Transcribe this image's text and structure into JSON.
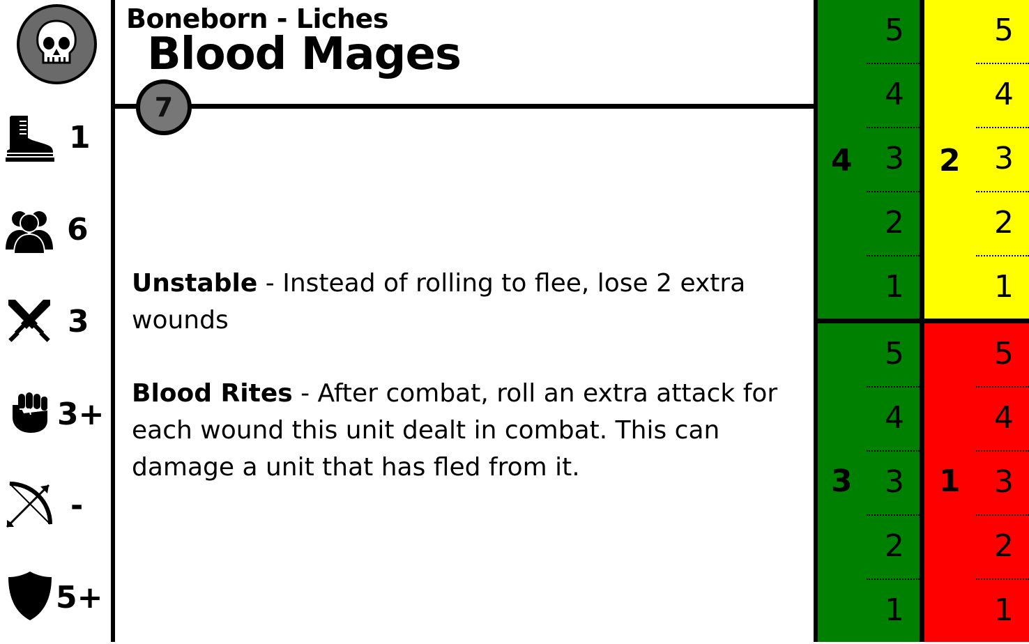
{
  "card": {
    "subtitle": "Boneborn - Liches",
    "title": "Blood Mages",
    "cost": "7"
  },
  "stats": [
    {
      "icon": "boot-icon",
      "value": "1"
    },
    {
      "icon": "group-icon",
      "value": "6"
    },
    {
      "icon": "crossed-swords-icon",
      "value": "3"
    },
    {
      "icon": "fist-icon",
      "value": "3+"
    },
    {
      "icon": "bow-icon",
      "value": "-"
    },
    {
      "icon": "shield-icon",
      "value": "5+"
    }
  ],
  "rules": [
    {
      "name": "Unstable",
      "text": " - Instead of rolling to flee, lose 2 extra wounds"
    },
    {
      "name": "Blood Rites",
      "text": " - After combat, roll an extra attack for each wound this unit dealt in combat. This can damage a unit that has fled from it."
    }
  ],
  "track": {
    "blocks": [
      {
        "label": "4",
        "color": "#008000",
        "numbers": [
          "5",
          "4",
          "3",
          "2",
          "1"
        ]
      },
      {
        "label": "2",
        "color": "#ffff00",
        "numbers": [
          "5",
          "4",
          "3",
          "2",
          "1"
        ]
      },
      {
        "label": "3",
        "color": "#008000",
        "numbers": [
          "5",
          "4",
          "3",
          "2",
          "1"
        ]
      },
      {
        "label": "1",
        "color": "#ff0000",
        "numbers": [
          "5",
          "4",
          "3",
          "2",
          "1"
        ]
      }
    ]
  }
}
